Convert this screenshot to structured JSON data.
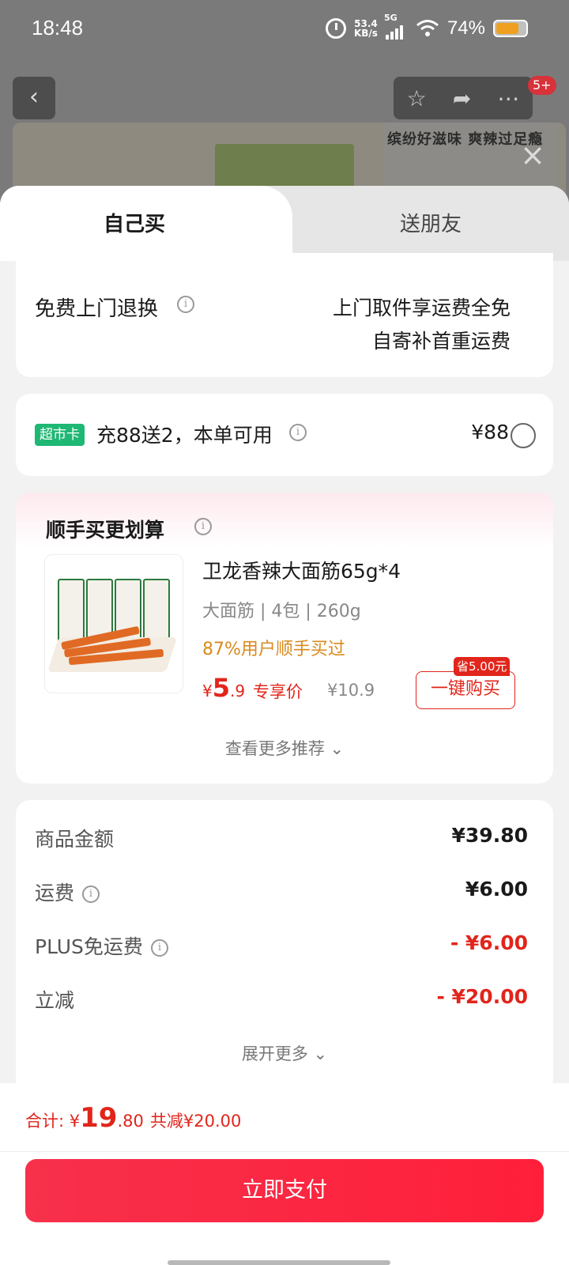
{
  "status_bar": {
    "time": "18:48",
    "net_speed_top": "53.4",
    "net_speed_bottom": "KB/s",
    "network": "5G",
    "battery": "74%"
  },
  "background": {
    "slogan": "缤纷好滋味 爽辣过足瘾",
    "notification_count": "5+"
  },
  "tabs": {
    "self_buy": "自己买",
    "gift_friend": "送朋友"
  },
  "return_service": {
    "title": "免费上门退换",
    "line1": "上门取件享运费全免",
    "line2": "自寄补首重运费"
  },
  "market_card": {
    "tag": "超市卡",
    "text": "充88送2，本单可用",
    "price": "¥88"
  },
  "addon": {
    "title": "顺手买更划算",
    "product_name": "卫龙香辣大面筋65g*4",
    "spec": "大面筋 | 4包 | 260g",
    "rate": "87%用户顺手买过",
    "price_symbol": "¥",
    "price_int": "5",
    "price_dec": ".9",
    "exclusive_label": "专享价",
    "original_price": "¥10.9",
    "save_tag": "省5.00元",
    "buy_button": "一键购买",
    "more": "查看更多推荐 ⌄"
  },
  "summary": {
    "rows": [
      {
        "label": "商品金额",
        "value": "¥39.80"
      },
      {
        "label": "运费",
        "value": "¥6.00"
      },
      {
        "label": "PLUS免运费",
        "value": "- ¥6.00"
      },
      {
        "label": "立减",
        "value": "- ¥20.00"
      }
    ],
    "expand": "展开更多 ⌄"
  },
  "footer": {
    "total_label": "合计: ¥",
    "total_int": "19",
    "total_dec": ".80",
    "total_cut": "共减¥20.00",
    "pay_button": "立即支付"
  },
  "colors": {
    "accent_red": "#e1251b",
    "market_green": "#1fb774",
    "rate_orange": "#d98a1e"
  }
}
